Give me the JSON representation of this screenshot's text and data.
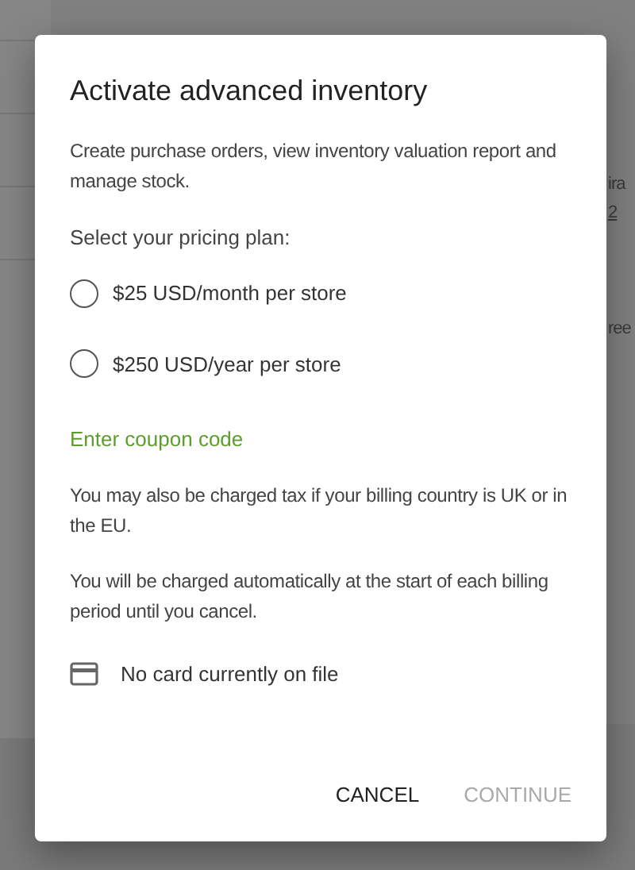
{
  "background": {
    "fragments": [
      "ira",
      "2",
      "ree"
    ]
  },
  "dialog": {
    "title": "Activate advanced inventory",
    "description": "Create purchase orders, view inventory valuation report and manage stock.",
    "plan_prompt": "Select your pricing plan:",
    "plans": [
      {
        "label": "$25 USD/month per store",
        "selected": false
      },
      {
        "label": "$250 USD/year per store",
        "selected": false
      }
    ],
    "coupon_link": "Enter coupon code",
    "notes": [
      "You may also be charged tax if your billing country is UK or in the EU.",
      "You will be charged automatically at the start of each billing period until you cancel."
    ],
    "card_status": "No card currently on file",
    "buttons": [
      {
        "label": "CANCEL",
        "disabled": false
      },
      {
        "label": "CONTINUE",
        "disabled": true
      }
    ]
  }
}
